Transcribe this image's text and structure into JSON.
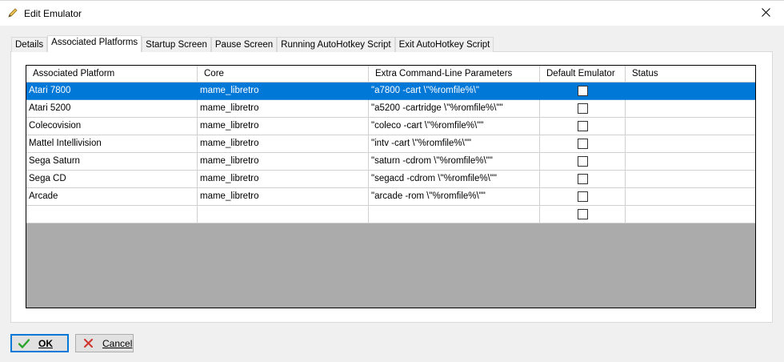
{
  "window": {
    "title": "Edit Emulator"
  },
  "tabs": [
    {
      "label": "Details",
      "active": false
    },
    {
      "label": "Associated Platforms",
      "active": true
    },
    {
      "label": "Startup Screen",
      "active": false
    },
    {
      "label": "Pause Screen",
      "active": false
    },
    {
      "label": "Running AutoHotkey Script",
      "active": false
    },
    {
      "label": "Exit AutoHotkey Script",
      "active": false
    }
  ],
  "grid": {
    "columns": [
      "Associated Platform",
      "Core",
      "Extra Command-Line Parameters",
      "Default Emulator",
      "Status"
    ],
    "rows": [
      {
        "platform": "Atari 7800",
        "core": "mame_libretro",
        "params": "\"a7800 -cart \\\"%romfile%\\\"",
        "default": false,
        "status": "",
        "selected": true
      },
      {
        "platform": "Atari 5200",
        "core": "mame_libretro",
        "params": "\"a5200 -cartridge \\\"%romfile%\\\"\"",
        "default": false,
        "status": "",
        "selected": false
      },
      {
        "platform": "Colecovision",
        "core": "mame_libretro",
        "params": "\"coleco -cart \\\"%romfile%\\\"\"",
        "default": false,
        "status": "",
        "selected": false
      },
      {
        "platform": "Mattel Intellivision",
        "core": "mame_libretro",
        "params": "\"intv -cart \\\"%romfile%\\\"\"",
        "default": false,
        "status": "",
        "selected": false
      },
      {
        "platform": "Sega Saturn",
        "core": "mame_libretro",
        "params": "\"saturn -cdrom \\\"%romfile%\\\"\"",
        "default": false,
        "status": "",
        "selected": false
      },
      {
        "platform": "Sega CD",
        "core": "mame_libretro",
        "params": "\"segacd -cdrom \\\"%romfile%\\\"\"",
        "default": false,
        "status": "",
        "selected": false
      },
      {
        "platform": "Arcade",
        "core": "mame_libretro",
        "params": "\"arcade -rom \\\"%romfile%\\\"\"",
        "default": false,
        "status": "",
        "selected": false
      },
      {
        "platform": "",
        "core": "",
        "params": "",
        "default": false,
        "status": "",
        "selected": false
      }
    ]
  },
  "buttons": {
    "ok_label": "OK",
    "cancel_label": "Cancel"
  },
  "icons": {
    "title": "pencil-icon",
    "close": "close-icon",
    "ok": "checkmark-icon",
    "cancel": "x-icon"
  },
  "colors": {
    "selection": "#0078d7",
    "ok_icon": "#2aa52a",
    "cancel_icon": "#d0342c"
  }
}
